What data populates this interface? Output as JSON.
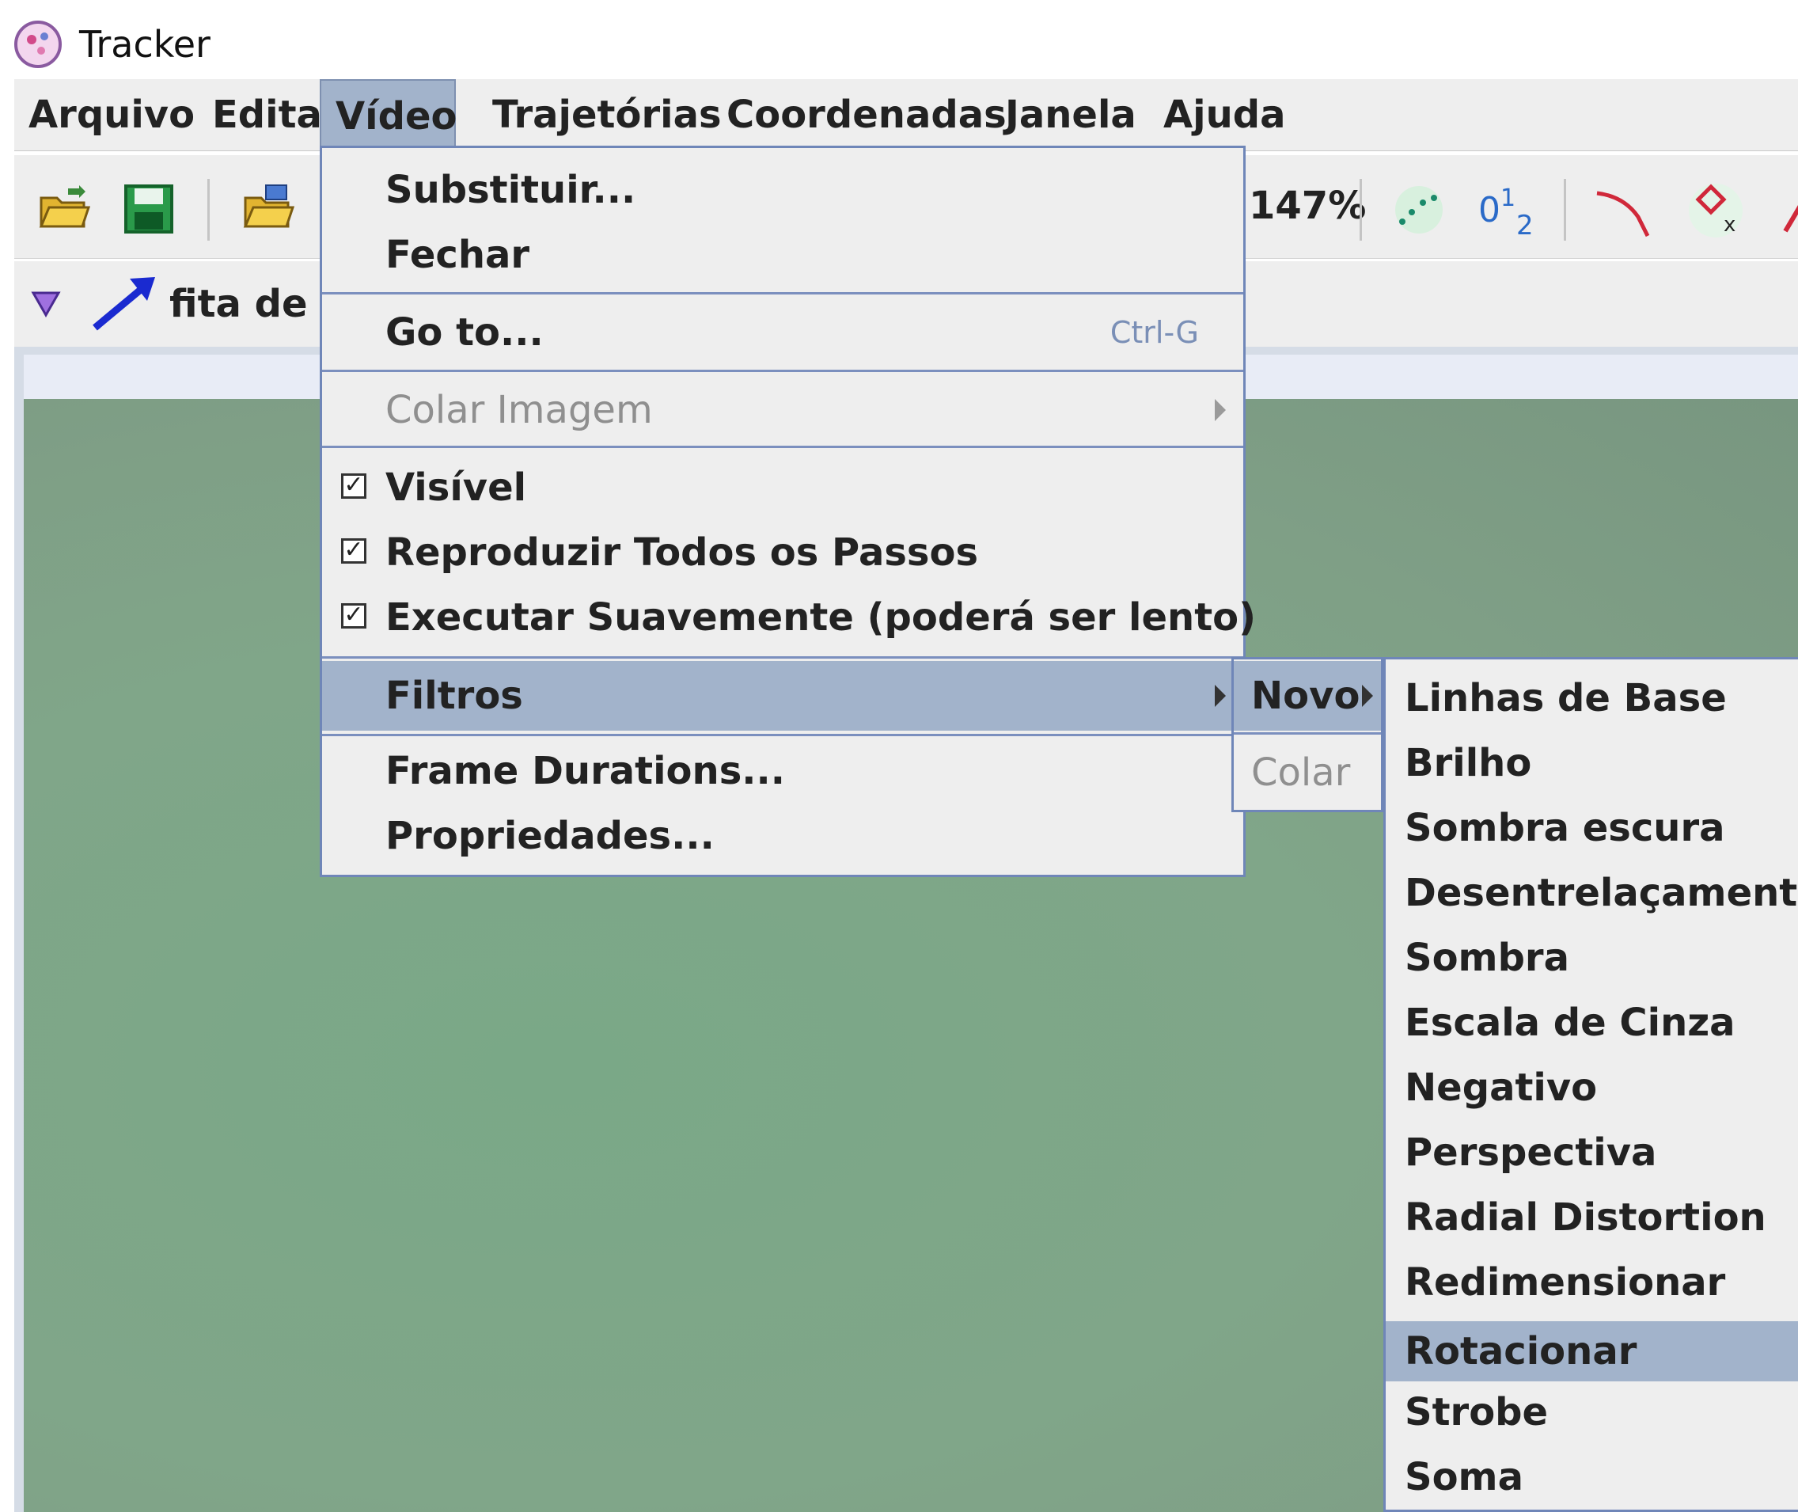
{
  "window": {
    "title": "Tracker",
    "icon": "tracker-app-icon"
  },
  "menubar": {
    "items": [
      "Arquivo",
      "Editar",
      "Vídeo",
      "Trajetórias",
      "Coordenadas",
      "Janela",
      "Ajuda"
    ],
    "active": "Vídeo"
  },
  "toolbar": {
    "zoom": "147%",
    "icons": [
      "open-folder-icon",
      "save-icon",
      "open-video-icon",
      "points-icon",
      "number-format-icon",
      "track-path-icon",
      "marker-delete-icon",
      "arrow-icon"
    ]
  },
  "trackbar": {
    "track_name": "fita de ca"
  },
  "video_menu": {
    "substituir": "Substituir...",
    "fechar": "Fechar",
    "goto": "Go to...",
    "goto_shortcut": "Ctrl-G",
    "colar_imagem": "Colar Imagem",
    "visivel": "Visível",
    "reproduzir": "Reproduzir Todos os Passos",
    "executar": "Executar Suavemente (poderá ser lento)",
    "filtros": "Filtros",
    "frame_durations": "Frame Durations...",
    "propriedades": "Propriedades..."
  },
  "filtros_menu": {
    "novo": "Novo",
    "colar": "Colar"
  },
  "novo_menu": {
    "items": [
      "Linhas de Base",
      "Brilho",
      "Sombra escura",
      "Desentrelaçamento",
      "Sombra",
      "Escala de Cinza",
      "Negativo",
      "Perspectiva",
      "Radial Distortion",
      "Redimensionar",
      "Rotacionar",
      "Strobe",
      "Soma"
    ],
    "selected": "Rotacionar"
  },
  "colors": {
    "menu_bg": "#eeeeee",
    "selection": "#a2b3cb",
    "menu_border": "#6f86b8",
    "video_green": "#7fa688"
  }
}
